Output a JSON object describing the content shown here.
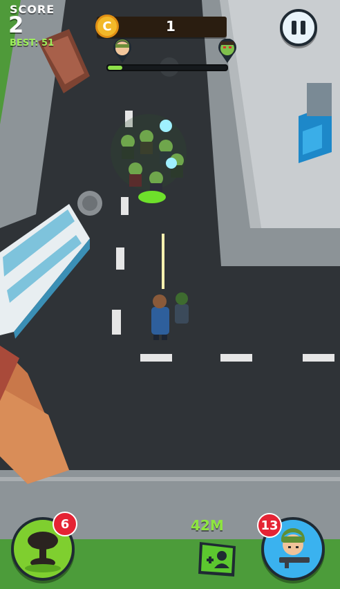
{
  "hud": {
    "score_label": "SCORE",
    "score_value": "2",
    "best": "BEST: 51",
    "coins": "1",
    "coin_symbol": "C",
    "wave_progress": 0.12
  },
  "abilities": {
    "nuke_count": "6",
    "soldier_count": "13",
    "distance": "42M"
  },
  "colors": {
    "accent_green": "#8fe04a",
    "coin_gold": "#f2b829",
    "badge_red": "#e52334",
    "soldier_blue": "#3ab2ef"
  },
  "icons": [
    "coin-icon",
    "pause-icon",
    "player-head-icon",
    "zombie-head-icon",
    "nuke-icon",
    "soldier-icon",
    "add-ally-icon"
  ]
}
